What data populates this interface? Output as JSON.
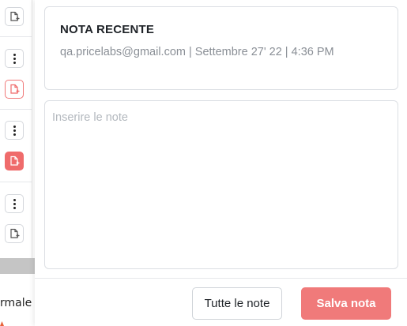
{
  "background": {
    "partial_text": "rmale"
  },
  "icons": {
    "add_note": "add-note-icon",
    "more": "more-vertical-icon"
  },
  "colors": {
    "accent": "#f07a7a",
    "accent_strong": "#ef6b6b",
    "border": "#dcdfe4",
    "muted_text": "#8a8f96"
  },
  "recent_note": {
    "title": "NOTA RECENTE",
    "meta": "qa.pricelabs@gmail.com | Settembre 27' 22 | 4:36 PM"
  },
  "notes_input": {
    "value": "",
    "placeholder": "Inserire le note"
  },
  "footer": {
    "all_notes_label": "Tutte le note",
    "save_label": "Salva nota"
  }
}
